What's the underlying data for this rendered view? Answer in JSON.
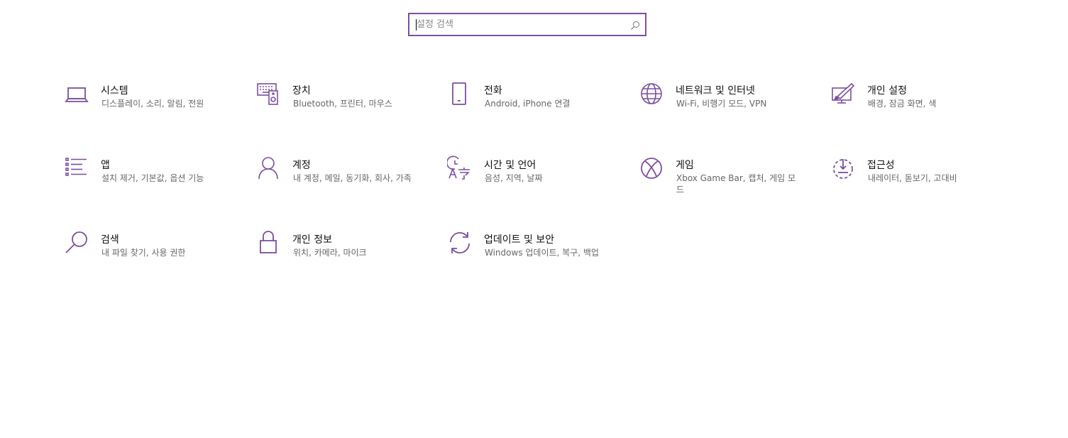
{
  "colors": {
    "accent": "#7a4fa0",
    "title_text": "#111111",
    "desc_text": "#666666",
    "background": "#ffffff"
  },
  "search": {
    "placeholder": "설정 검색",
    "value": "",
    "icon": "search-icon"
  },
  "categories": [
    {
      "icon": "laptop-icon",
      "title": "시스템",
      "desc": "디스플레이, 소리, 알림, 전원"
    },
    {
      "icon": "keyboard-speaker-icon",
      "title": "장치",
      "desc": "Bluetooth, 프린터, 마우스"
    },
    {
      "icon": "phone-icon",
      "title": "전화",
      "desc": "Android, iPhone 연결"
    },
    {
      "icon": "globe-icon",
      "title": "네트워크 및 인터넷",
      "desc": "Wi-Fi, 비행기 모드, VPN"
    },
    {
      "icon": "paint-monitor-icon",
      "title": "개인 설정",
      "desc": "배경, 잠금 화면, 색"
    },
    {
      "icon": "apps-list-icon",
      "title": "앱",
      "desc": "설치 제거, 기본값, 옵션 기능"
    },
    {
      "icon": "person-icon",
      "title": "계정",
      "desc": "내 계정, 메일, 동기화, 회사, 가족"
    },
    {
      "icon": "time-language-icon",
      "title": "시간 및 언어",
      "desc": "음성, 지역, 날짜"
    },
    {
      "icon": "xbox-icon",
      "title": "게임",
      "desc": "Xbox Game Bar, 캡처, 게임 모드"
    },
    {
      "icon": "ease-of-access-icon",
      "title": "접근성",
      "desc": "내레이터, 돋보기, 고대비"
    },
    {
      "icon": "magnifier-icon",
      "title": "검색",
      "desc": "내 파일 찾기, 사용 권한"
    },
    {
      "icon": "lock-icon",
      "title": "개인 정보",
      "desc": "위치, 카메라, 마이크"
    },
    {
      "icon": "sync-icon",
      "title": "업데이트 및 보안",
      "desc": "Windows 업데이트, 복구, 백업"
    }
  ]
}
